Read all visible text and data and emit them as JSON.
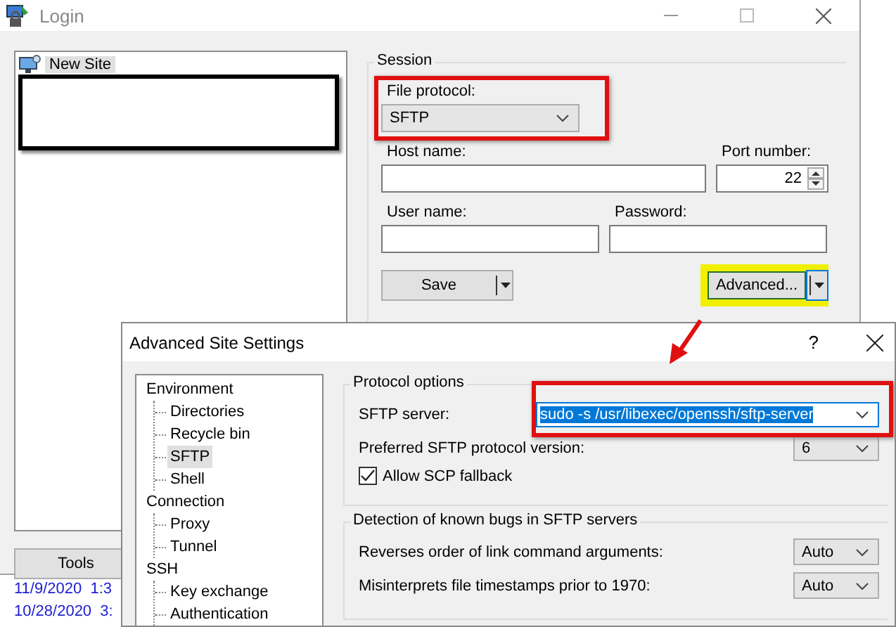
{
  "login": {
    "title": "Login",
    "sites": [
      {
        "label": "New Site",
        "selected": true
      }
    ],
    "tools_button": "Tools",
    "session": {
      "title": "Session",
      "file_protocol": {
        "label": "File protocol:",
        "value": "SFTP"
      },
      "host_name": {
        "label": "Host name:"
      },
      "port_number": {
        "label": "Port number:",
        "value": "22"
      },
      "user_name": {
        "label": "User name:"
      },
      "password": {
        "label": "Password:"
      },
      "save_button": "Save",
      "advanced_button": "Advanced..."
    }
  },
  "log_entries": [
    "11/9/2020  1:3",
    "10/28/2020  3:"
  ],
  "advanced_dialog": {
    "title": "Advanced Site Settings",
    "help": "?",
    "tree": [
      {
        "label": "Environment",
        "selected": false,
        "children": [
          {
            "label": "Directories",
            "selected": false
          },
          {
            "label": "Recycle bin",
            "selected": false
          },
          {
            "label": "SFTP",
            "selected": true
          },
          {
            "label": "Shell",
            "selected": false
          }
        ]
      },
      {
        "label": "Connection",
        "selected": false,
        "children": [
          {
            "label": "Proxy",
            "selected": false
          },
          {
            "label": "Tunnel",
            "selected": false
          }
        ]
      },
      {
        "label": "SSH",
        "selected": false,
        "children": [
          {
            "label": "Key exchange",
            "selected": false
          },
          {
            "label": "Authentication",
            "selected": false
          }
        ]
      }
    ],
    "protocol_options": {
      "title": "Protocol options",
      "sftp_server": {
        "label": "SFTP server:",
        "value": "sudo -s /usr/libexec/openssh/sftp-server",
        "selected": true
      },
      "preferred_version": {
        "label": "Preferred SFTP protocol version:",
        "value": "6"
      },
      "allow_scp_fallback": {
        "label": "Allow SCP fallback",
        "checked": true
      }
    },
    "bug_detection": {
      "title": "Detection of known bugs in SFTP servers",
      "rows": [
        {
          "label": "Reverses order of link command arguments:",
          "value": "Auto"
        },
        {
          "label": "Misinterprets file timestamps prior to 1970:",
          "value": "Auto"
        }
      ]
    }
  }
}
